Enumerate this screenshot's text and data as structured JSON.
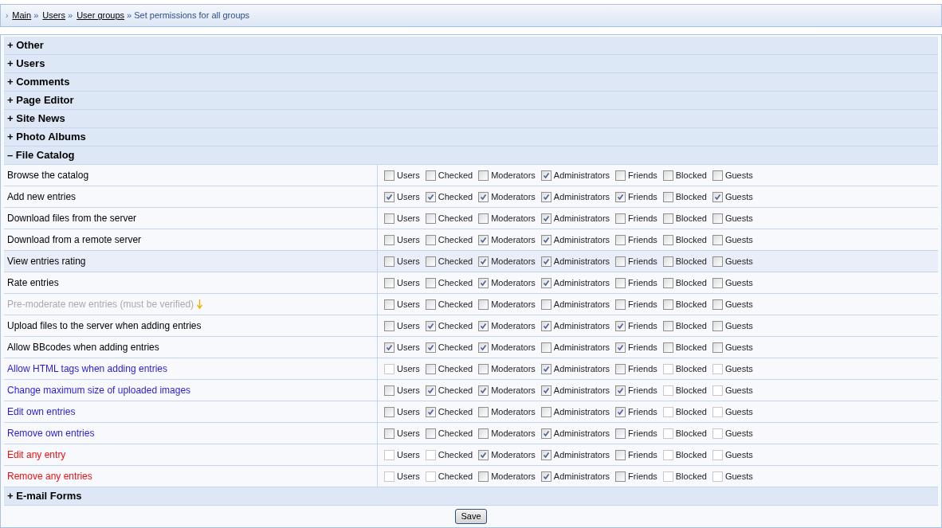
{
  "breadcrumb": {
    "marker": "›",
    "separator": "»",
    "links": [
      "Main",
      "Users",
      "User groups"
    ],
    "current": "Set permissions for all groups"
  },
  "sections": [
    {
      "sign": "+",
      "title": "Other"
    },
    {
      "sign": "+",
      "title": "Users"
    },
    {
      "sign": "+",
      "title": "Comments"
    },
    {
      "sign": "+",
      "title": "Page Editor"
    },
    {
      "sign": "+",
      "title": "Site News"
    },
    {
      "sign": "+",
      "title": "Photo Albums"
    },
    {
      "sign": "–",
      "title": "File Catalog",
      "rows": [
        {
          "label": "Browse the catalog",
          "color": "#000000",
          "hint": false,
          "highlighted": false,
          "perms": [
            {
              "group": "Users",
              "checked": false,
              "disabled": false
            },
            {
              "group": "Checked",
              "checked": false,
              "disabled": false
            },
            {
              "group": "Moderators",
              "checked": false,
              "disabled": false
            },
            {
              "group": "Administrators",
              "checked": true,
              "disabled": false
            },
            {
              "group": "Friends",
              "checked": false,
              "disabled": false
            },
            {
              "group": "Blocked",
              "checked": false,
              "disabled": false
            },
            {
              "group": "Guests",
              "checked": false,
              "disabled": false
            }
          ]
        },
        {
          "label": "Add new entries",
          "color": "#000000",
          "hint": false,
          "highlighted": false,
          "perms": [
            {
              "group": "Users",
              "checked": true,
              "disabled": false
            },
            {
              "group": "Checked",
              "checked": true,
              "disabled": false
            },
            {
              "group": "Moderators",
              "checked": true,
              "disabled": false
            },
            {
              "group": "Administrators",
              "checked": true,
              "disabled": false
            },
            {
              "group": "Friends",
              "checked": true,
              "disabled": false
            },
            {
              "group": "Blocked",
              "checked": false,
              "disabled": false
            },
            {
              "group": "Guests",
              "checked": true,
              "disabled": false
            }
          ]
        },
        {
          "label": "Download files from the server",
          "color": "#000000",
          "hint": false,
          "highlighted": false,
          "perms": [
            {
              "group": "Users",
              "checked": false,
              "disabled": false
            },
            {
              "group": "Checked",
              "checked": false,
              "disabled": false
            },
            {
              "group": "Moderators",
              "checked": false,
              "disabled": false
            },
            {
              "group": "Administrators",
              "checked": true,
              "disabled": false
            },
            {
              "group": "Friends",
              "checked": false,
              "disabled": false
            },
            {
              "group": "Blocked",
              "checked": false,
              "disabled": false
            },
            {
              "group": "Guests",
              "checked": false,
              "disabled": false
            }
          ]
        },
        {
          "label": "Download from a remote server",
          "color": "#000000",
          "hint": false,
          "highlighted": false,
          "perms": [
            {
              "group": "Users",
              "checked": false,
              "disabled": false
            },
            {
              "group": "Checked",
              "checked": false,
              "disabled": false
            },
            {
              "group": "Moderators",
              "checked": true,
              "disabled": false
            },
            {
              "group": "Administrators",
              "checked": true,
              "disabled": false
            },
            {
              "group": "Friends",
              "checked": false,
              "disabled": false
            },
            {
              "group": "Blocked",
              "checked": false,
              "disabled": false
            },
            {
              "group": "Guests",
              "checked": false,
              "disabled": false
            }
          ]
        },
        {
          "label": "View entries rating",
          "color": "#000000",
          "hint": false,
          "highlighted": true,
          "perms": [
            {
              "group": "Users",
              "checked": false,
              "disabled": false
            },
            {
              "group": "Checked",
              "checked": false,
              "disabled": false
            },
            {
              "group": "Moderators",
              "checked": true,
              "disabled": false
            },
            {
              "group": "Administrators",
              "checked": true,
              "disabled": false
            },
            {
              "group": "Friends",
              "checked": false,
              "disabled": false
            },
            {
              "group": "Blocked",
              "checked": false,
              "disabled": false
            },
            {
              "group": "Guests",
              "checked": false,
              "disabled": false
            }
          ]
        },
        {
          "label": "Rate entries",
          "color": "#000000",
          "hint": false,
          "highlighted": false,
          "perms": [
            {
              "group": "Users",
              "checked": false,
              "disabled": false
            },
            {
              "group": "Checked",
              "checked": false,
              "disabled": false
            },
            {
              "group": "Moderators",
              "checked": true,
              "disabled": false
            },
            {
              "group": "Administrators",
              "checked": true,
              "disabled": false
            },
            {
              "group": "Friends",
              "checked": false,
              "disabled": false
            },
            {
              "group": "Blocked",
              "checked": false,
              "disabled": false
            },
            {
              "group": "Guests",
              "checked": false,
              "disabled": false
            }
          ]
        },
        {
          "label": "Pre-moderate new entries (must be verified)",
          "color": "#aaaaaa",
          "hint": true,
          "highlighted": false,
          "perms": [
            {
              "group": "Users",
              "checked": false,
              "disabled": false
            },
            {
              "group": "Checked",
              "checked": false,
              "disabled": false
            },
            {
              "group": "Moderators",
              "checked": false,
              "disabled": false
            },
            {
              "group": "Administrators",
              "checked": false,
              "disabled": false
            },
            {
              "group": "Friends",
              "checked": false,
              "disabled": false
            },
            {
              "group": "Blocked",
              "checked": false,
              "disabled": false
            },
            {
              "group": "Guests",
              "checked": false,
              "disabled": false
            }
          ]
        },
        {
          "label": "Upload files to the server when adding entries",
          "color": "#000000",
          "hint": false,
          "highlighted": false,
          "perms": [
            {
              "group": "Users",
              "checked": false,
              "disabled": false
            },
            {
              "group": "Checked",
              "checked": true,
              "disabled": false
            },
            {
              "group": "Moderators",
              "checked": true,
              "disabled": false
            },
            {
              "group": "Administrators",
              "checked": true,
              "disabled": false
            },
            {
              "group": "Friends",
              "checked": true,
              "disabled": false
            },
            {
              "group": "Blocked",
              "checked": false,
              "disabled": false
            },
            {
              "group": "Guests",
              "checked": false,
              "disabled": false
            }
          ]
        },
        {
          "label": "Allow BBcodes when adding entries",
          "color": "#000000",
          "hint": false,
          "highlighted": false,
          "perms": [
            {
              "group": "Users",
              "checked": true,
              "disabled": false
            },
            {
              "group": "Checked",
              "checked": true,
              "disabled": false
            },
            {
              "group": "Moderators",
              "checked": true,
              "disabled": false
            },
            {
              "group": "Administrators",
              "checked": false,
              "disabled": false
            },
            {
              "group": "Friends",
              "checked": true,
              "disabled": false
            },
            {
              "group": "Blocked",
              "checked": false,
              "disabled": false
            },
            {
              "group": "Guests",
              "checked": false,
              "disabled": false
            }
          ]
        },
        {
          "label": "Allow HTML tags when adding entries",
          "color": "#2a1bdb",
          "hint": false,
          "highlighted": false,
          "perms": [
            {
              "group": "Users",
              "checked": false,
              "disabled": true
            },
            {
              "group": "Checked",
              "checked": false,
              "disabled": false
            },
            {
              "group": "Moderators",
              "checked": false,
              "disabled": false
            },
            {
              "group": "Administrators",
              "checked": true,
              "disabled": false
            },
            {
              "group": "Friends",
              "checked": false,
              "disabled": false
            },
            {
              "group": "Blocked",
              "checked": false,
              "disabled": true
            },
            {
              "group": "Guests",
              "checked": false,
              "disabled": true
            }
          ]
        },
        {
          "label": "Change maximum size of uploaded images",
          "color": "#2a1bdb",
          "hint": false,
          "highlighted": false,
          "perms": [
            {
              "group": "Users",
              "checked": false,
              "disabled": false
            },
            {
              "group": "Checked",
              "checked": true,
              "disabled": false
            },
            {
              "group": "Moderators",
              "checked": true,
              "disabled": false
            },
            {
              "group": "Administrators",
              "checked": true,
              "disabled": false
            },
            {
              "group": "Friends",
              "checked": true,
              "disabled": false
            },
            {
              "group": "Blocked",
              "checked": false,
              "disabled": true
            },
            {
              "group": "Guests",
              "checked": false,
              "disabled": true
            }
          ]
        },
        {
          "label": "Edit own entries",
          "color": "#2a1bdb",
          "hint": false,
          "highlighted": false,
          "perms": [
            {
              "group": "Users",
              "checked": false,
              "disabled": false
            },
            {
              "group": "Checked",
              "checked": true,
              "disabled": false
            },
            {
              "group": "Moderators",
              "checked": false,
              "disabled": false
            },
            {
              "group": "Administrators",
              "checked": false,
              "disabled": false
            },
            {
              "group": "Friends",
              "checked": true,
              "disabled": false
            },
            {
              "group": "Blocked",
              "checked": false,
              "disabled": true
            },
            {
              "group": "Guests",
              "checked": false,
              "disabled": true
            }
          ]
        },
        {
          "label": "Remove own entries",
          "color": "#2a1bdb",
          "hint": false,
          "highlighted": false,
          "perms": [
            {
              "group": "Users",
              "checked": false,
              "disabled": false
            },
            {
              "group": "Checked",
              "checked": false,
              "disabled": false
            },
            {
              "group": "Moderators",
              "checked": false,
              "disabled": false
            },
            {
              "group": "Administrators",
              "checked": true,
              "disabled": false
            },
            {
              "group": "Friends",
              "checked": false,
              "disabled": false
            },
            {
              "group": "Blocked",
              "checked": false,
              "disabled": true
            },
            {
              "group": "Guests",
              "checked": false,
              "disabled": true
            }
          ]
        },
        {
          "label": "Edit any entry",
          "color": "#ee1111",
          "hint": false,
          "highlighted": false,
          "perms": [
            {
              "group": "Users",
              "checked": false,
              "disabled": true
            },
            {
              "group": "Checked",
              "checked": false,
              "disabled": true
            },
            {
              "group": "Moderators",
              "checked": true,
              "disabled": false
            },
            {
              "group": "Administrators",
              "checked": true,
              "disabled": false
            },
            {
              "group": "Friends",
              "checked": false,
              "disabled": false
            },
            {
              "group": "Blocked",
              "checked": false,
              "disabled": true
            },
            {
              "group": "Guests",
              "checked": false,
              "disabled": true
            }
          ]
        },
        {
          "label": "Remove any entries",
          "color": "#ee1111",
          "hint": false,
          "highlighted": false,
          "perms": [
            {
              "group": "Users",
              "checked": false,
              "disabled": true
            },
            {
              "group": "Checked",
              "checked": false,
              "disabled": true
            },
            {
              "group": "Moderators",
              "checked": false,
              "disabled": false
            },
            {
              "group": "Administrators",
              "checked": true,
              "disabled": false
            },
            {
              "group": "Friends",
              "checked": false,
              "disabled": false
            },
            {
              "group": "Blocked",
              "checked": false,
              "disabled": true
            },
            {
              "group": "Guests",
              "checked": false,
              "disabled": true
            }
          ]
        }
      ]
    },
    {
      "sign": "+",
      "title": "E-mail Forms"
    }
  ],
  "save_button": "Save"
}
